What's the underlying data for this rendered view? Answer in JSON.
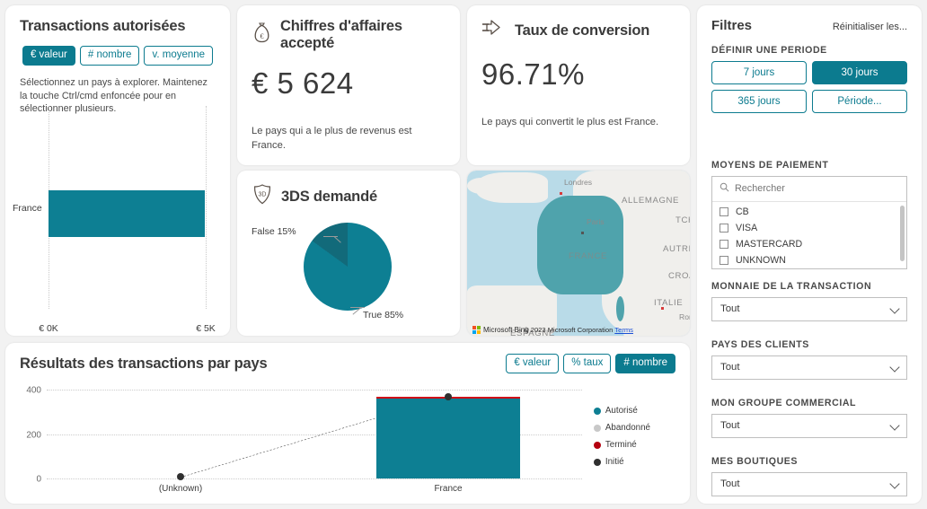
{
  "authorized": {
    "title": "Transactions autorisées",
    "toggles": [
      {
        "label": "€ valeur",
        "active": true
      },
      {
        "label": "# nombre",
        "active": false
      },
      {
        "label": "v. moyenne",
        "active": false
      }
    ],
    "helper": "Sélectionnez un pays à explorer. Maintenez la touche Ctrl/cmd enfoncée pour en sélectionner plusieurs.",
    "chart_data": {
      "type": "bar",
      "orientation": "horizontal",
      "title": "Transactions autorisées",
      "categories": [
        "France"
      ],
      "values": [
        5624
      ],
      "xlabel": "",
      "ylabel": "",
      "xlim": [
        0,
        5000
      ],
      "xticks": [
        0,
        5000
      ],
      "xtick_labels": [
        "€ 0K",
        "€ 5K"
      ],
      "grid": true,
      "series_color": "#0d7f93"
    }
  },
  "revenue": {
    "icon": "money-bag-icon",
    "title": "Chiffres d'affaires accepté",
    "value": "€ 5 624",
    "subtitle": "Le pays qui a le plus de revenus est France."
  },
  "conversion": {
    "icon": "conversion-arrow-icon",
    "title": "Taux de conversion",
    "value": "96.71%",
    "subtitle": "Le pays qui convertit le plus est France."
  },
  "threeds": {
    "icon": "3ds-shield-icon",
    "title": "3DS demandé",
    "chart_data": {
      "type": "pie",
      "title": "3DS demandé",
      "labels": [
        "True",
        "False"
      ],
      "values": [
        85,
        15
      ],
      "display_labels": [
        "True 85%",
        "False 15%"
      ],
      "colors": [
        "#0d7f93",
        "#126a7a"
      ],
      "legend": "labels-outside"
    }
  },
  "map": {
    "labels": [
      "Londres",
      "ALLEMAGNE",
      "Paris",
      "FRANCE",
      "AUTRIC",
      "ITALIE",
      "Rom",
      "CROA",
      "TCH",
      "ESPAGNE"
    ],
    "highlighted_country": "FRANCE",
    "highlight_color": "#4fa3ac",
    "provider": "Microsoft Bing",
    "copyright": "© 2023 Microsoft Corporation",
    "terms": "Terms"
  },
  "filters": {
    "title": "Filtres",
    "reset_label": "Réinitialiser les...",
    "period": {
      "label": "DÉFINIR UNE PERIODE",
      "options": [
        {
          "label": "7 jours",
          "active": false
        },
        {
          "label": "30 jours",
          "active": true
        },
        {
          "label": "365 jours",
          "active": false
        },
        {
          "label": "Période...",
          "active": false
        }
      ]
    },
    "payment_methods": {
      "label": "MOYENS DE PAIEMENT",
      "search_placeholder": "Rechercher",
      "search_value": "",
      "options": [
        {
          "label": "CB",
          "checked": false
        },
        {
          "label": "VISA",
          "checked": false
        },
        {
          "label": "MASTERCARD",
          "checked": false
        },
        {
          "label": "UNKNOWN",
          "checked": false
        }
      ]
    },
    "currency": {
      "label": "MONNAIE DE LA TRANSACTION",
      "value": "Tout"
    },
    "customer_country": {
      "label": "PAYS DES CLIENTS",
      "value": "Tout"
    },
    "commercial_group": {
      "label": "MON GROUPE COMMERCIAL",
      "value": "Tout"
    },
    "shops": {
      "label": "MES BOUTIQUES",
      "value": "Tout"
    }
  },
  "results": {
    "title": "Résultats des transactions par pays",
    "toggles": [
      {
        "label": "€ valeur",
        "active": false
      },
      {
        "label": "% taux",
        "active": false
      },
      {
        "label": "# nombre",
        "active": true
      }
    ],
    "chart_data": {
      "type": "bar",
      "title": "Résultats des transactions par pays",
      "categories": [
        "(Unknown)",
        "France"
      ],
      "xlabel": "",
      "ylabel": "",
      "ylim": [
        0,
        400
      ],
      "yticks": [
        0,
        200,
        400
      ],
      "ytick_labels": [
        "0",
        "200",
        "400"
      ],
      "grid": true,
      "series": [
        {
          "name": "Autorisé",
          "type": "bar",
          "color": "#0d7f93",
          "values": [
            0,
            358
          ]
        },
        {
          "name": "Abandonné",
          "type": "marker",
          "color": "#c8c8c8",
          "values": [
            0,
            0
          ]
        },
        {
          "name": "Terminé",
          "type": "line",
          "color": "#cf0a18",
          "values": [
            0,
            364
          ]
        },
        {
          "name": "Initié",
          "type": "line-marker",
          "color": "#2f2f2f",
          "values": [
            5,
            370
          ]
        }
      ],
      "legend": [
        {
          "label": "Autorisé",
          "color": "#0d7f93"
        },
        {
          "label": "Abandonné",
          "color": "#c8c8c8"
        },
        {
          "label": "Terminé",
          "color": "#b5000f"
        },
        {
          "label": "Initié",
          "color": "#2f2f2f"
        }
      ]
    }
  }
}
